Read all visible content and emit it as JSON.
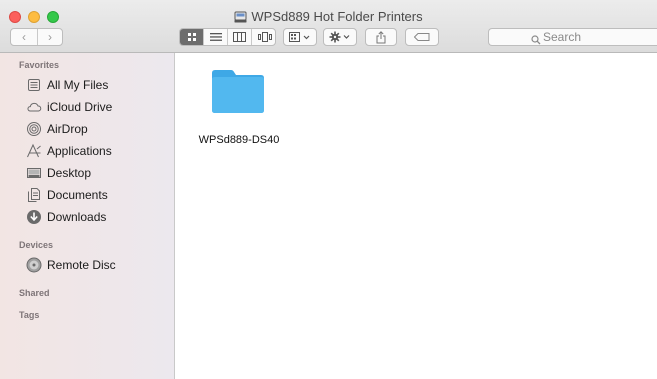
{
  "window": {
    "title": "WPSd889 Hot Folder Printers",
    "title_icon": "external-drive-icon"
  },
  "toolbar": {
    "back_glyph": "‹",
    "forward_glyph": "›",
    "view_modes": [
      "icon-view",
      "list-view",
      "column-view",
      "cover-flow-view"
    ],
    "active_view": "icon-view",
    "search_placeholder": "Search"
  },
  "sidebar": {
    "favorites_title": "Favorites",
    "favorites": [
      {
        "label": "All My Files",
        "icon": "all-files-icon"
      },
      {
        "label": "iCloud Drive",
        "icon": "cloud-icon"
      },
      {
        "label": "AirDrop",
        "icon": "airdrop-icon"
      },
      {
        "label": "Applications",
        "icon": "applications-icon"
      },
      {
        "label": "Desktop",
        "icon": "desktop-icon"
      },
      {
        "label": "Documents",
        "icon": "documents-icon"
      },
      {
        "label": "Downloads",
        "icon": "downloads-icon"
      }
    ],
    "devices_title": "Devices",
    "devices": [
      {
        "label": "Remote Disc",
        "icon": "remote-disc-icon"
      }
    ],
    "shared_title": "Shared",
    "tags_title": "Tags"
  },
  "content": {
    "items": [
      {
        "name": "WPSd889-DS40",
        "icon": "folder-icon"
      }
    ]
  },
  "colors": {
    "folder": "#52b8ef",
    "close": "#fc605c",
    "minimize": "#fdbc40",
    "maximize": "#34c84a",
    "sidebar_tint": "#f2e5e3"
  }
}
